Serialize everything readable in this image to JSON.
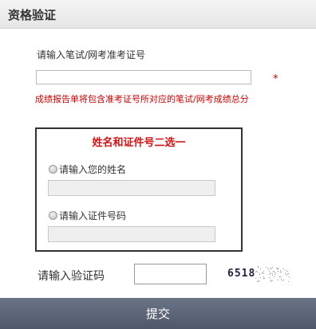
{
  "header": {
    "title": "资格验证"
  },
  "ticket": {
    "label": "请输入笔试/网考准考证号",
    "value": "",
    "required_mark": "*",
    "hint": "成绩报告单将包含准考证号所对应的笔试/网考成绩总分"
  },
  "choice": {
    "title": "姓名和证件号二选一",
    "name_option": {
      "label": "请输入您的姓名",
      "value": ""
    },
    "id_option": {
      "label": "请输入证件号码",
      "value": ""
    }
  },
  "captcha": {
    "label": "请输入验证码",
    "value": "",
    "image_text": "6518"
  },
  "submit": {
    "label": "提交"
  },
  "colors": {
    "accent_red": "#cc0000",
    "submit_bar": "#5a6374"
  }
}
